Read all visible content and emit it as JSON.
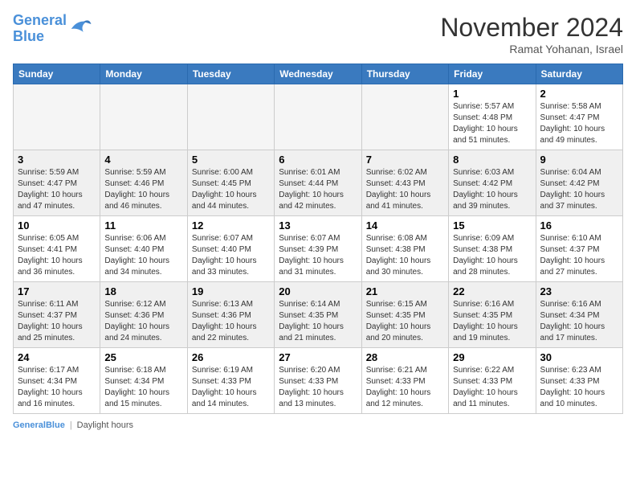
{
  "header": {
    "logo_line1": "General",
    "logo_line2": "Blue",
    "month": "November 2024",
    "location": "Ramat Yohanan, Israel"
  },
  "days_of_week": [
    "Sunday",
    "Monday",
    "Tuesday",
    "Wednesday",
    "Thursday",
    "Friday",
    "Saturday"
  ],
  "weeks": [
    [
      {
        "num": "",
        "info": "",
        "empty": true
      },
      {
        "num": "",
        "info": "",
        "empty": true
      },
      {
        "num": "",
        "info": "",
        "empty": true
      },
      {
        "num": "",
        "info": "",
        "empty": true
      },
      {
        "num": "",
        "info": "",
        "empty": true
      },
      {
        "num": "1",
        "info": "Sunrise: 5:57 AM\nSunset: 4:48 PM\nDaylight: 10 hours\nand 51 minutes.",
        "empty": false
      },
      {
        "num": "2",
        "info": "Sunrise: 5:58 AM\nSunset: 4:47 PM\nDaylight: 10 hours\nand 49 minutes.",
        "empty": false
      }
    ],
    [
      {
        "num": "3",
        "info": "Sunrise: 5:59 AM\nSunset: 4:47 PM\nDaylight: 10 hours\nand 47 minutes.",
        "empty": false
      },
      {
        "num": "4",
        "info": "Sunrise: 5:59 AM\nSunset: 4:46 PM\nDaylight: 10 hours\nand 46 minutes.",
        "empty": false
      },
      {
        "num": "5",
        "info": "Sunrise: 6:00 AM\nSunset: 4:45 PM\nDaylight: 10 hours\nand 44 minutes.",
        "empty": false
      },
      {
        "num": "6",
        "info": "Sunrise: 6:01 AM\nSunset: 4:44 PM\nDaylight: 10 hours\nand 42 minutes.",
        "empty": false
      },
      {
        "num": "7",
        "info": "Sunrise: 6:02 AM\nSunset: 4:43 PM\nDaylight: 10 hours\nand 41 minutes.",
        "empty": false
      },
      {
        "num": "8",
        "info": "Sunrise: 6:03 AM\nSunset: 4:42 PM\nDaylight: 10 hours\nand 39 minutes.",
        "empty": false
      },
      {
        "num": "9",
        "info": "Sunrise: 6:04 AM\nSunset: 4:42 PM\nDaylight: 10 hours\nand 37 minutes.",
        "empty": false
      }
    ],
    [
      {
        "num": "10",
        "info": "Sunrise: 6:05 AM\nSunset: 4:41 PM\nDaylight: 10 hours\nand 36 minutes.",
        "empty": false
      },
      {
        "num": "11",
        "info": "Sunrise: 6:06 AM\nSunset: 4:40 PM\nDaylight: 10 hours\nand 34 minutes.",
        "empty": false
      },
      {
        "num": "12",
        "info": "Sunrise: 6:07 AM\nSunset: 4:40 PM\nDaylight: 10 hours\nand 33 minutes.",
        "empty": false
      },
      {
        "num": "13",
        "info": "Sunrise: 6:07 AM\nSunset: 4:39 PM\nDaylight: 10 hours\nand 31 minutes.",
        "empty": false
      },
      {
        "num": "14",
        "info": "Sunrise: 6:08 AM\nSunset: 4:38 PM\nDaylight: 10 hours\nand 30 minutes.",
        "empty": false
      },
      {
        "num": "15",
        "info": "Sunrise: 6:09 AM\nSunset: 4:38 PM\nDaylight: 10 hours\nand 28 minutes.",
        "empty": false
      },
      {
        "num": "16",
        "info": "Sunrise: 6:10 AM\nSunset: 4:37 PM\nDaylight: 10 hours\nand 27 minutes.",
        "empty": false
      }
    ],
    [
      {
        "num": "17",
        "info": "Sunrise: 6:11 AM\nSunset: 4:37 PM\nDaylight: 10 hours\nand 25 minutes.",
        "empty": false
      },
      {
        "num": "18",
        "info": "Sunrise: 6:12 AM\nSunset: 4:36 PM\nDaylight: 10 hours\nand 24 minutes.",
        "empty": false
      },
      {
        "num": "19",
        "info": "Sunrise: 6:13 AM\nSunset: 4:36 PM\nDaylight: 10 hours\nand 22 minutes.",
        "empty": false
      },
      {
        "num": "20",
        "info": "Sunrise: 6:14 AM\nSunset: 4:35 PM\nDaylight: 10 hours\nand 21 minutes.",
        "empty": false
      },
      {
        "num": "21",
        "info": "Sunrise: 6:15 AM\nSunset: 4:35 PM\nDaylight: 10 hours\nand 20 minutes.",
        "empty": false
      },
      {
        "num": "22",
        "info": "Sunrise: 6:16 AM\nSunset: 4:35 PM\nDaylight: 10 hours\nand 19 minutes.",
        "empty": false
      },
      {
        "num": "23",
        "info": "Sunrise: 6:16 AM\nSunset: 4:34 PM\nDaylight: 10 hours\nand 17 minutes.",
        "empty": false
      }
    ],
    [
      {
        "num": "24",
        "info": "Sunrise: 6:17 AM\nSunset: 4:34 PM\nDaylight: 10 hours\nand 16 minutes.",
        "empty": false
      },
      {
        "num": "25",
        "info": "Sunrise: 6:18 AM\nSunset: 4:34 PM\nDaylight: 10 hours\nand 15 minutes.",
        "empty": false
      },
      {
        "num": "26",
        "info": "Sunrise: 6:19 AM\nSunset: 4:33 PM\nDaylight: 10 hours\nand 14 minutes.",
        "empty": false
      },
      {
        "num": "27",
        "info": "Sunrise: 6:20 AM\nSunset: 4:33 PM\nDaylight: 10 hours\nand 13 minutes.",
        "empty": false
      },
      {
        "num": "28",
        "info": "Sunrise: 6:21 AM\nSunset: 4:33 PM\nDaylight: 10 hours\nand 12 minutes.",
        "empty": false
      },
      {
        "num": "29",
        "info": "Sunrise: 6:22 AM\nSunset: 4:33 PM\nDaylight: 10 hours\nand 11 minutes.",
        "empty": false
      },
      {
        "num": "30",
        "info": "Sunrise: 6:23 AM\nSunset: 4:33 PM\nDaylight: 10 hours\nand 10 minutes.",
        "empty": false
      }
    ]
  ],
  "footer": {
    "logo_line1": "General",
    "logo_line2": "Blue",
    "daylight_label": "Daylight hours"
  }
}
